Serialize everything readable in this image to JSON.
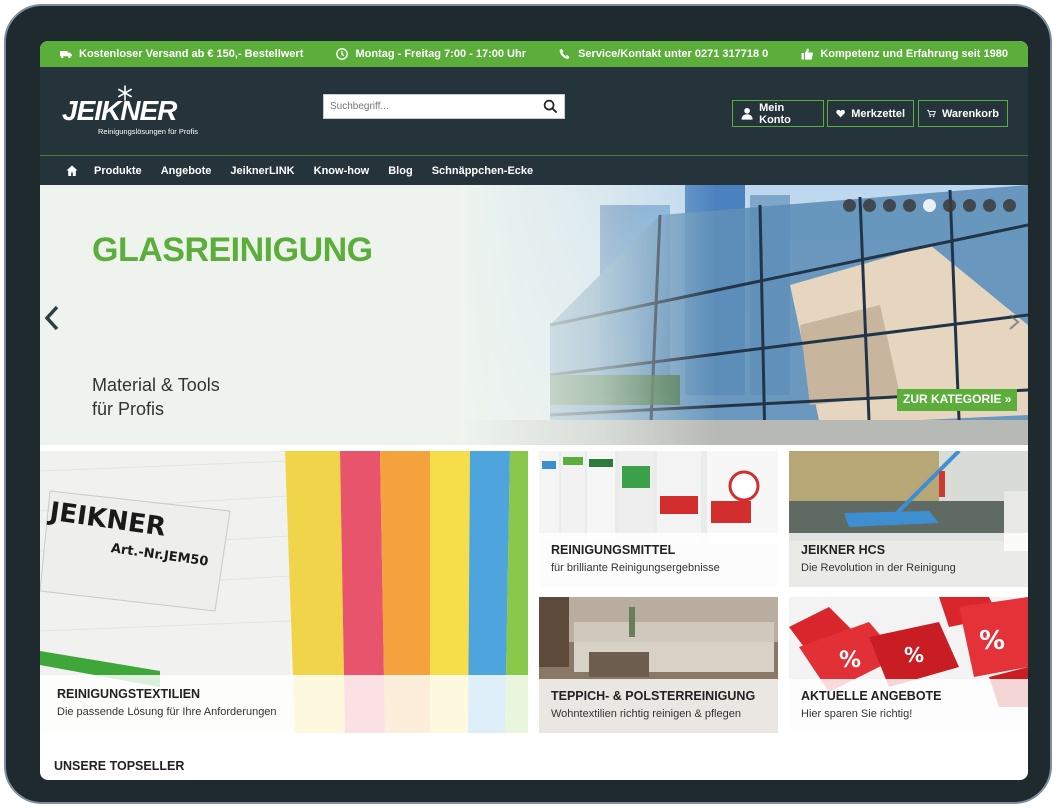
{
  "topbar": {
    "items": [
      {
        "icon": "truck-icon",
        "text": "Kostenloser Versand ab € 150,- Bestellwert"
      },
      {
        "icon": "clock-icon",
        "text": "Montag - Freitag 7:00 - 17:00 Uhr"
      },
      {
        "icon": "phone-icon",
        "text": "Service/Kontakt unter 0271 317718 0"
      },
      {
        "icon": "thumbs-up-icon",
        "text": "Kompetenz und Erfahrung seit 1980"
      }
    ]
  },
  "header": {
    "logo_text": "JEIKNER",
    "logo_sub": "Reinigungslösungen für Profis",
    "search_placeholder": "Suchbegriff...",
    "account_label": "Mein Konto",
    "wishlist_label": "Merkzettel",
    "cart_label": "Warenkorb"
  },
  "nav": {
    "items": [
      "Produkte",
      "Angebote",
      "JeiknerLINK",
      "Know-how",
      "Blog",
      "Schnäppchen-Ecke"
    ]
  },
  "hero": {
    "title": "GLASREINIGUNG",
    "subtitle_line1": "Material & Tools",
    "subtitle_line2": "für Profis",
    "cta": "ZUR KATEGORIE »",
    "slide_count": 9,
    "active_slide": 5
  },
  "tiles": [
    {
      "title": "REINIGUNGSTEXTILIEN",
      "desc": "Die passende Lösung für Ihre Anforderungen",
      "label_text": "JEIKNER",
      "label_art": "Art.-Nr.JEM50"
    },
    {
      "title": "REINIGUNGSMITTEL",
      "desc": "für brilliante Reinigungsergebnisse"
    },
    {
      "title": "JEIKNER HCS",
      "desc": "Die Revolution in der Reinigung"
    },
    {
      "title": "TEPPICH- & POLSTERREINIGUNG",
      "desc": "Wohntextilien richtig reinigen & pflegen"
    },
    {
      "title": "AKTUELLE ANGEBOTE",
      "desc": "Hier sparen Sie richtig!"
    }
  ],
  "topseller_heading": "UNSERE TOPSELLER",
  "colors": {
    "accent": "#5cae3a",
    "header_bg": "#25343a"
  }
}
